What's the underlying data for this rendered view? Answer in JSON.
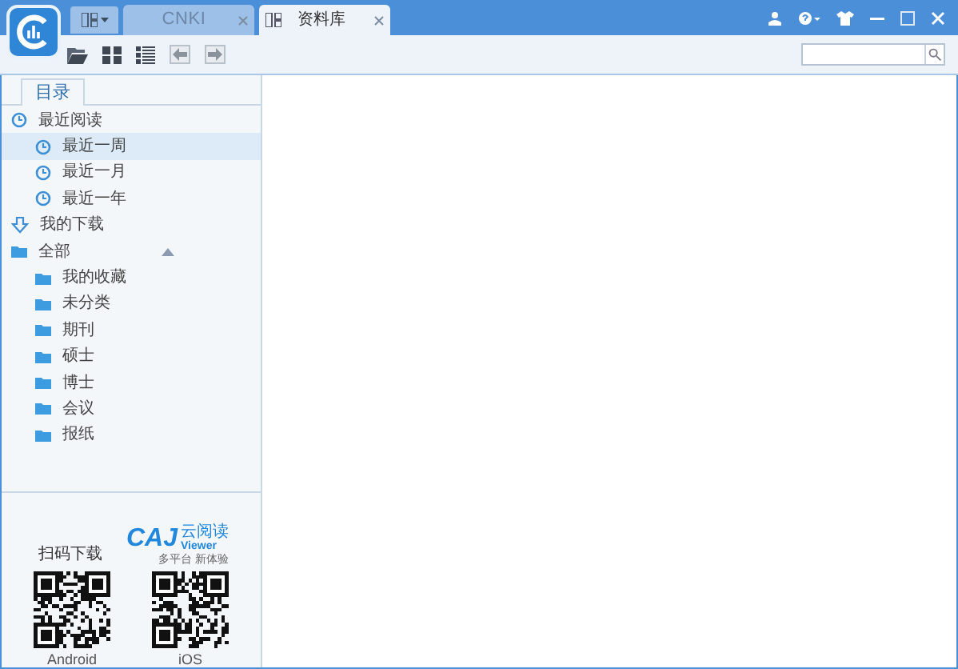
{
  "tabs": [
    {
      "kind": "brand",
      "label": "CNKI",
      "selected": false
    },
    {
      "kind": "library",
      "label": "资料库",
      "selected": true
    }
  ],
  "sidebar": {
    "tab": "目录",
    "tree": [
      {
        "kind": "clock",
        "label": "最近阅读",
        "selected": false,
        "expanded": true,
        "children": [
          {
            "kind": "clock",
            "label": "最近一周",
            "selected": true
          },
          {
            "kind": "clock",
            "label": "最近一月",
            "selected": false
          },
          {
            "kind": "clock",
            "label": "最近一年",
            "selected": false
          }
        ]
      },
      {
        "kind": "download",
        "label": "我的下载",
        "selected": false
      },
      {
        "kind": "folder",
        "label": "全部",
        "selected": false,
        "expanded": true,
        "children": [
          {
            "kind": "folder",
            "label": "我的收藏",
            "selected": false
          },
          {
            "kind": "folder",
            "label": "未分类",
            "selected": false
          },
          {
            "kind": "folder",
            "label": "期刊",
            "selected": false
          },
          {
            "kind": "folder",
            "label": "硕士",
            "selected": false
          },
          {
            "kind": "folder",
            "label": "博士",
            "selected": false
          },
          {
            "kind": "folder",
            "label": "会议",
            "selected": false
          },
          {
            "kind": "folder",
            "label": "报纸",
            "selected": false
          }
        ]
      }
    ]
  },
  "promo": {
    "scan_label": "扫码下载",
    "logo": "CAJ",
    "logo_cn": "云阅读",
    "logo_en": "Viewer",
    "slogan": "多平台 新体验",
    "qr_codes": [
      {
        "label": "Android"
      },
      {
        "label": "iOS"
      }
    ]
  }
}
